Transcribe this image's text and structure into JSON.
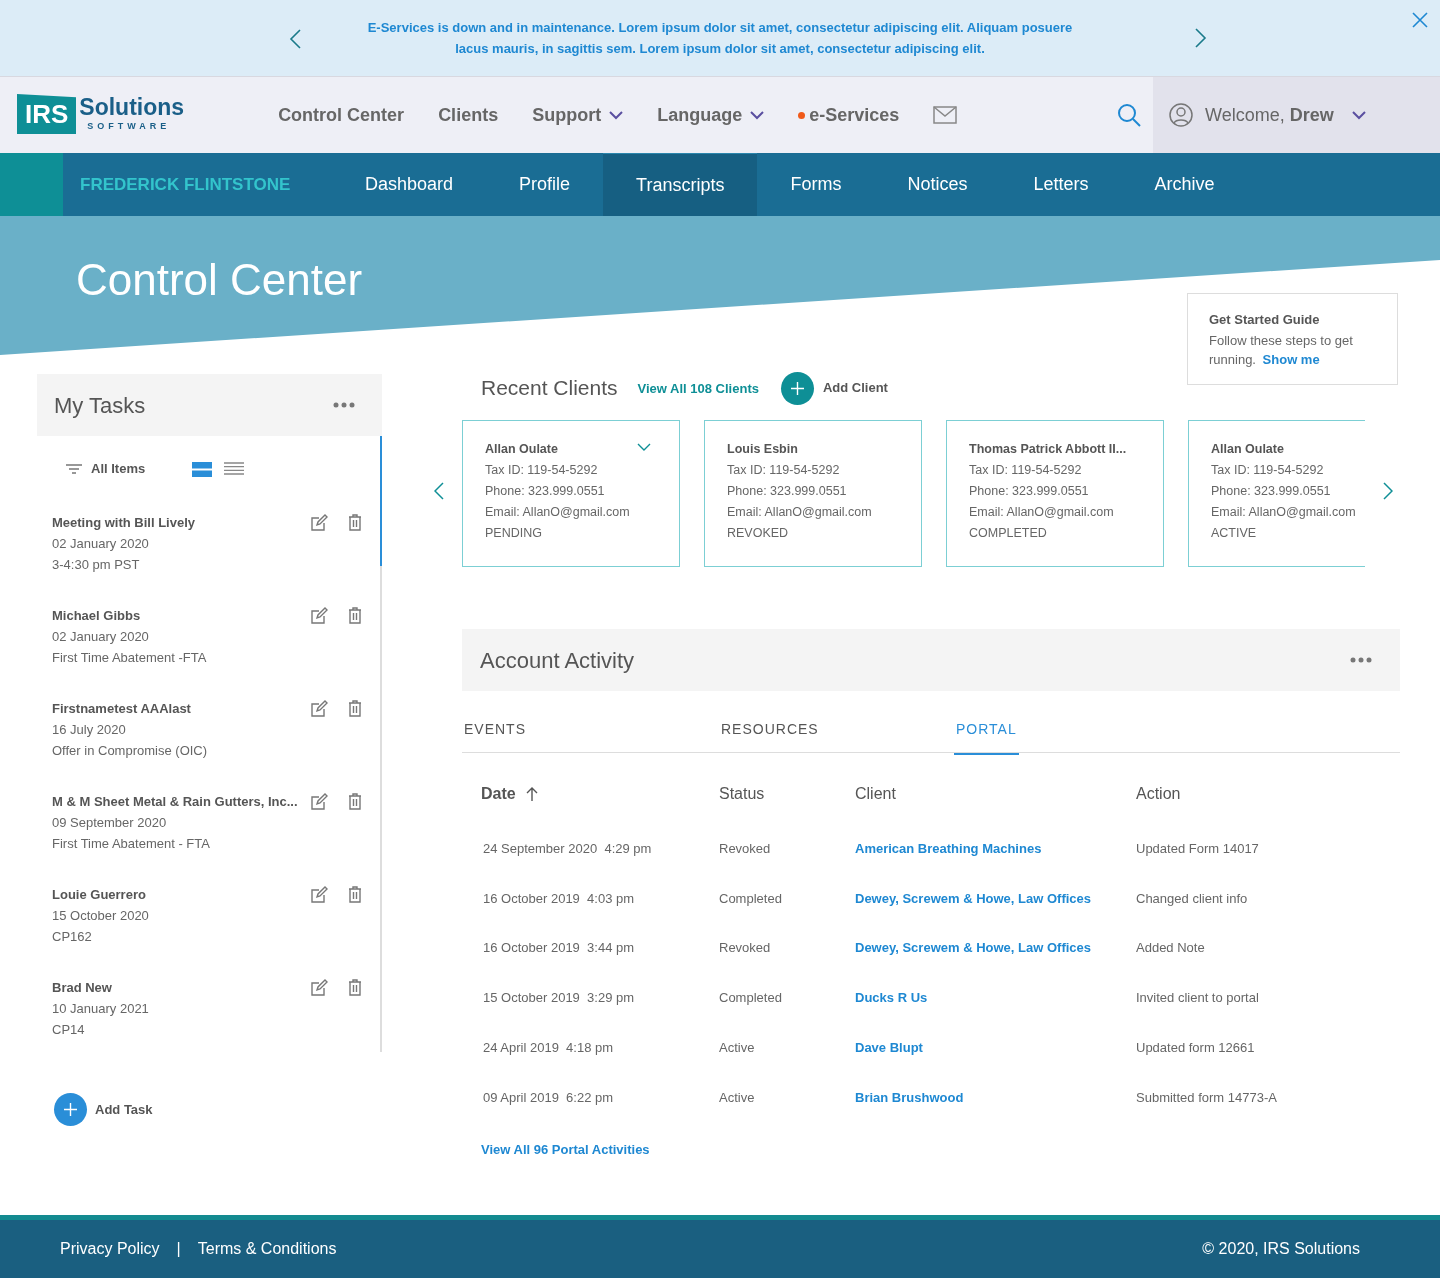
{
  "banner": {
    "message": "E-Services is down and in maintenance. Lorem ipsum dolor sit amet, consectetur adipiscing elit. Aliquam posuere lacus mauris, in sagittis sem. Lorem ipsum dolor sit amet, consectetur adipiscing elit."
  },
  "header": {
    "logo_main": "IRS",
    "logo_word": "Solutions",
    "logo_sub": "SOFTWARE",
    "menu": [
      {
        "label": "Control Center",
        "dropdown": false,
        "alert": false
      },
      {
        "label": "Clients",
        "dropdown": false,
        "alert": false
      },
      {
        "label": "Support",
        "dropdown": true,
        "alert": false
      },
      {
        "label": "Language",
        "dropdown": true,
        "alert": false
      },
      {
        "label": "e-Services",
        "dropdown": false,
        "alert": true
      }
    ],
    "welcome": "Welcome, **Drew**"
  },
  "client_nav": {
    "client_name": "FREDERICK FLINTSTONE",
    "items": [
      {
        "label": "Dashboard",
        "selected": false
      },
      {
        "label": "Profile",
        "selected": false
      },
      {
        "label": "Transcripts",
        "selected": true
      },
      {
        "label": "Forms",
        "selected": false
      },
      {
        "label": "Notices",
        "selected": false
      },
      {
        "label": "Letters",
        "selected": false
      },
      {
        "label": "Archive",
        "selected": false
      }
    ]
  },
  "page_title": "Control Center",
  "guide": {
    "title": "Get Started Guide",
    "text": "Follow these steps to get running.",
    "link": "Show me"
  },
  "tasks": {
    "title": "My Tasks",
    "filter": "All Items",
    "view_modes": [
      {
        "kind": "cards",
        "selected": true
      },
      {
        "kind": "list",
        "selected": false
      }
    ],
    "items": [
      {
        "title": "Meeting with Bill Lively",
        "date": "02 January 2020",
        "note": "3-4:30 pm PST"
      },
      {
        "title": "Michael Gibbs",
        "date": "02 January 2020",
        "note": "First Time Abatement -FTA"
      },
      {
        "title": "Firstnametest AAAlast",
        "date": "16 July 2020",
        "note": "Offer in Compromise (OIC)"
      },
      {
        "title": "M & M Sheet Metal & Rain Gutters, Inc...",
        "date": "09 September 2020",
        "note": "First Time Abatement - FTA"
      },
      {
        "title": "Louie Guerrero",
        "date": "15 October 2020",
        "note": "CP162"
      },
      {
        "title": "Brad New",
        "date": "10 January 2021",
        "note": "CP14"
      }
    ],
    "add": "Add Task"
  },
  "recent_clients": {
    "title": "Recent Clients",
    "view_all": "View All 108 Clients",
    "add": "Add Client",
    "cards": [
      {
        "name": "Allan Oulate",
        "tax_id": "Tax ID: 119-54-5292",
        "phone": "Phone: 323.999.0551",
        "email": "Email: AllanO@gmail.com",
        "status": "PENDING",
        "collapsible": true
      },
      {
        "name": "Louis Esbin",
        "tax_id": "Tax ID: 119-54-5292",
        "phone": "Phone: 323.999.0551",
        "email": "Email: AllanO@gmail.com",
        "status": "REVOKED",
        "collapsible": false
      },
      {
        "name": "Thomas Patrick Abbott II...",
        "tax_id": "Tax ID: 119-54-5292",
        "phone": "Phone: 323.999.0551",
        "email": "Email: AllanO@gmail.com",
        "status": "COMPLETED",
        "collapsible": false
      },
      {
        "name": "Allan Oulate",
        "tax_id": "Tax ID: 119-54-5292",
        "phone": "Phone: 323.999.0551",
        "email": "Email: AllanO@gmail.com",
        "status": "ACTIVE",
        "collapsible": false
      }
    ]
  },
  "account_activity": {
    "title": "Account Activity",
    "tabs": [
      {
        "label": "EVENTS",
        "selected": false
      },
      {
        "label": "RESOURCES",
        "selected": false
      },
      {
        "label": "PORTAL",
        "selected": true
      }
    ],
    "columns": [
      "Date",
      "Status",
      "Client",
      "Action"
    ],
    "rows": [
      {
        "date": "24 September 2020  4:29 pm",
        "status": "Revoked",
        "client": "American Breathing Machines",
        "action": "Updated Form 14017"
      },
      {
        "date": "16 October 2019  4:03 pm",
        "status": "Completed",
        "client": "Dewey, Screwem & Howe, Law Offices",
        "action": "Changed client info"
      },
      {
        "date": "16 October 2019  3:44 pm",
        "status": "Revoked",
        "client": "Dewey, Screwem & Howe, Law Offices",
        "action": "Added Note"
      },
      {
        "date": "15 October 2019  3:29 pm",
        "status": "Completed",
        "client": "Ducks R Us",
        "action": "Invited client to portal"
      },
      {
        "date": "24 April 2019  4:18 pm",
        "status": "Active",
        "client": "Dave Blupt",
        "action": "Updated form 12661"
      },
      {
        "date": "09 April 2019  6:22 pm",
        "status": "Active",
        "client": "Brian Brushwood",
        "action": "Submitted form 14773-A"
      }
    ],
    "view_all": "View All 96 Portal Activities"
  },
  "footer": {
    "links": [
      "Privacy Policy",
      "Terms & Conditions"
    ],
    "separator": "|",
    "copyright": "© 2020, IRS Solutions"
  }
}
